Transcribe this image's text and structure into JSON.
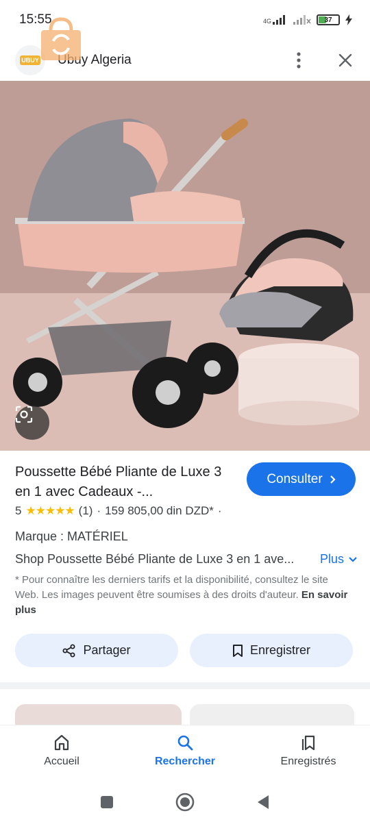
{
  "status_bar": {
    "time": "15:55",
    "network": "4G",
    "battery": "37"
  },
  "header": {
    "site_logo_text": "UBUY",
    "site_name": "Ubuy Algeria",
    "menu_icon": "more-vert-icon",
    "close_icon": "close-icon"
  },
  "product": {
    "title": "Poussette Bébé Pliante de Luxe 3 en 1 avec Cadeaux -...",
    "visit_label": "Consulter",
    "rating_value": "5",
    "stars": "★★★★★",
    "review_count": "(1)",
    "separator": "·",
    "price": "159 805,00 din DZD*",
    "brand": "Marque : MATÉRIEL",
    "shop_text": "Shop Poussette Bébé Pliante de Luxe 3 en 1 ave...",
    "more_label": "Plus",
    "disclaimer": "* Pour connaître les derniers tarifs et la disponibilité, consultez le site Web. Les images peuvent être soumises à des droits d'auteur.",
    "learn_more": "En savoir plus"
  },
  "actions": {
    "share_label": "Partager",
    "save_label": "Enregistrer"
  },
  "bottom_nav": {
    "items": [
      {
        "label": "Accueil",
        "icon": "home-icon"
      },
      {
        "label": "Rechercher",
        "icon": "search-icon"
      },
      {
        "label": "Enregistrés",
        "icon": "saved-icon"
      }
    ]
  },
  "colors": {
    "accent": "#1a73e8",
    "button_bg": "#e8f0fe",
    "star": "#fbbc04"
  }
}
